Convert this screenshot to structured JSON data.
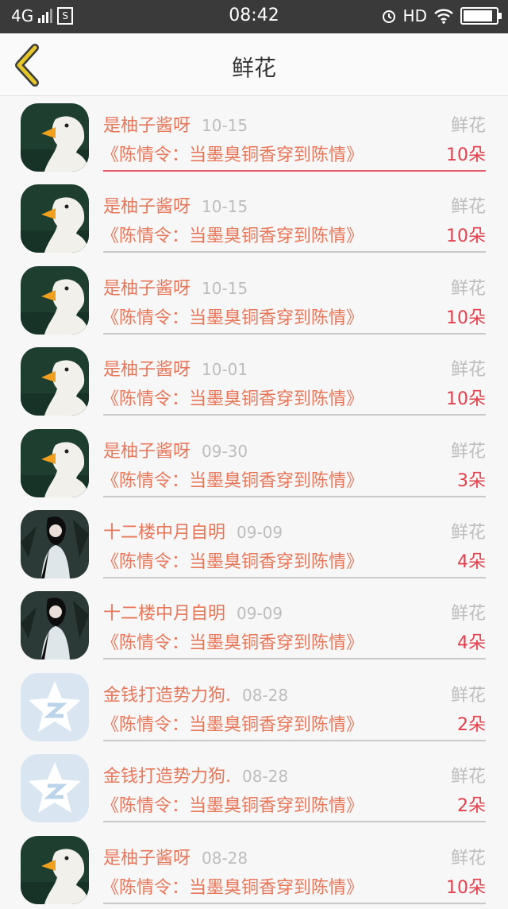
{
  "status_bar": {
    "network": "4G",
    "sim_label": "S",
    "time": "08:42",
    "hd_label": "HD"
  },
  "header": {
    "title": "鲜花"
  },
  "colors": {
    "accent": "#e8775a",
    "quantity": "#e4404c",
    "muted": "#bdbdbd",
    "back_icon": "#e6c72a"
  },
  "records": [
    {
      "avatar": "duck-avatar",
      "name": "是柚子酱呀",
      "date": "10-15",
      "type": "鲜花",
      "book": "《陈情令：当墨臭铜香穿到陈情》",
      "quantity": "10朵"
    },
    {
      "avatar": "duck-avatar",
      "name": "是柚子酱呀",
      "date": "10-15",
      "type": "鲜花",
      "book": "《陈情令：当墨臭铜香穿到陈情》",
      "quantity": "10朵"
    },
    {
      "avatar": "duck-avatar",
      "name": "是柚子酱呀",
      "date": "10-15",
      "type": "鲜花",
      "book": "《陈情令：当墨臭铜香穿到陈情》",
      "quantity": "10朵"
    },
    {
      "avatar": "duck-avatar",
      "name": "是柚子酱呀",
      "date": "10-01",
      "type": "鲜花",
      "book": "《陈情令：当墨臭铜香穿到陈情》",
      "quantity": "10朵"
    },
    {
      "avatar": "duck-avatar",
      "name": "是柚子酱呀",
      "date": "09-30",
      "type": "鲜花",
      "book": "《陈情令：当墨臭铜香穿到陈情》",
      "quantity": "3朵"
    },
    {
      "avatar": "girl-avatar",
      "name": "十二楼中月自明",
      "date": "09-09",
      "type": "鲜花",
      "book": "《陈情令：当墨臭铜香穿到陈情》",
      "quantity": "4朵"
    },
    {
      "avatar": "girl-avatar",
      "name": "十二楼中月自明",
      "date": "09-09",
      "type": "鲜花",
      "book": "《陈情令：当墨臭铜香穿到陈情》",
      "quantity": "4朵"
    },
    {
      "avatar": "qzone-avatar",
      "name": "金钱打造势力狗.",
      "date": "08-28",
      "type": "鲜花",
      "book": "《陈情令：当墨臭铜香穿到陈情》",
      "quantity": "2朵"
    },
    {
      "avatar": "qzone-avatar",
      "name": "金钱打造势力狗.",
      "date": "08-28",
      "type": "鲜花",
      "book": "《陈情令：当墨臭铜香穿到陈情》",
      "quantity": "2朵"
    },
    {
      "avatar": "duck-avatar",
      "name": "是柚子酱呀",
      "date": "08-28",
      "type": "鲜花",
      "book": "《陈情令：当墨臭铜香穿到陈情》",
      "quantity": "10朵"
    }
  ]
}
